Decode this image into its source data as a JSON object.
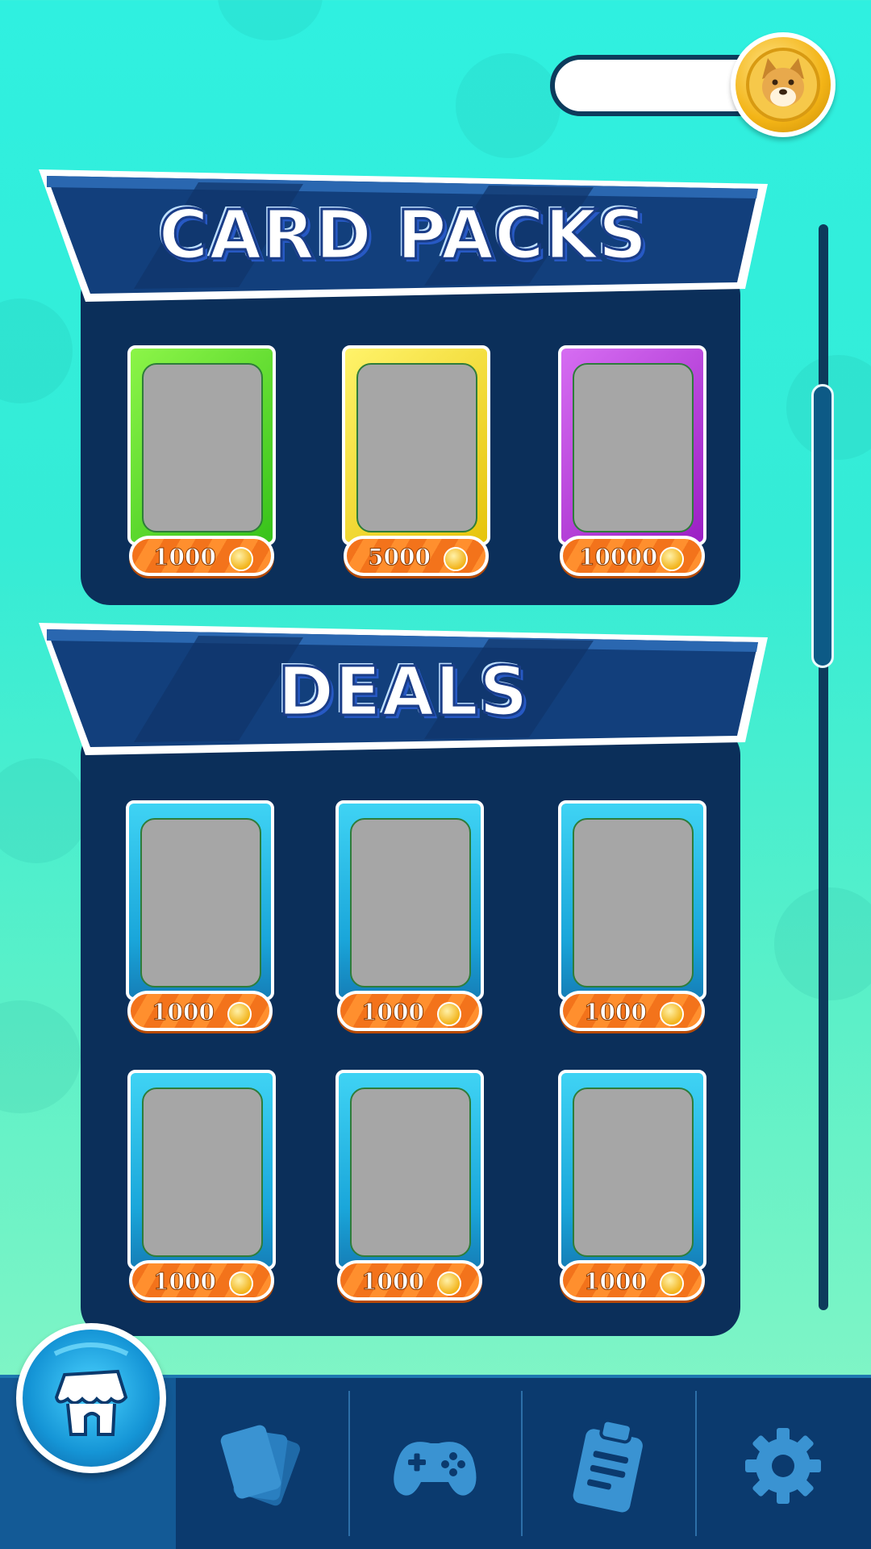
{
  "header": {
    "coin_balance": "",
    "coin_icon": "doge-coin-icon"
  },
  "sections": {
    "card_packs": {
      "title": "CARD PACKS",
      "packs": [
        {
          "price": "1000",
          "color": "green"
        },
        {
          "price": "5000",
          "color": "yellow"
        },
        {
          "price": "10000",
          "color": "purple"
        }
      ]
    },
    "deals": {
      "title": "DEALS",
      "items": [
        {
          "price": "1000"
        },
        {
          "price": "1000"
        },
        {
          "price": "1000"
        },
        {
          "price": "1000"
        },
        {
          "price": "1000"
        },
        {
          "price": "1000"
        }
      ]
    }
  },
  "nav": {
    "items": [
      {
        "icon": "shop-icon",
        "active": true
      },
      {
        "icon": "cards-icon",
        "active": false
      },
      {
        "icon": "gamepad-icon",
        "active": false
      },
      {
        "icon": "clipboard-icon",
        "active": false
      },
      {
        "icon": "gear-icon",
        "active": false
      }
    ]
  },
  "colors": {
    "panel": "#0b2f5a",
    "price_orange": "#f3731b",
    "nav_bg": "#0b3a6e",
    "accent_cyan": "#2ff0e0"
  }
}
